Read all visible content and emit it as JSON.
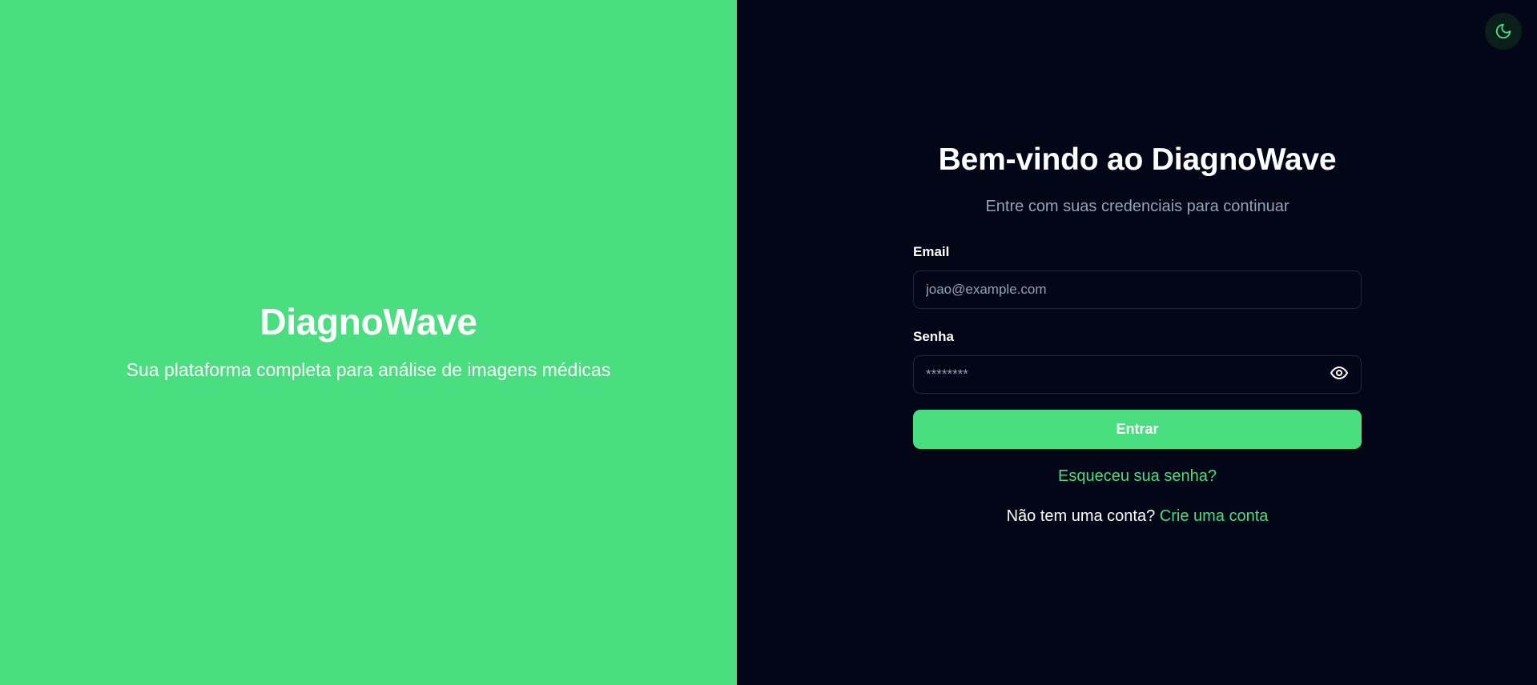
{
  "brand": {
    "title": "DiagnoWave",
    "tagline": "Sua plataforma completa para análise de imagens médicas"
  },
  "theme_toggle": {
    "icon": "moon-icon"
  },
  "login": {
    "title": "Bem-vindo ao DiagnoWave",
    "subtitle": "Entre com suas credenciais para continuar",
    "email_label": "Email",
    "email_placeholder": "joao@example.com",
    "email_value": "",
    "password_label": "Senha",
    "password_placeholder": "********",
    "password_value": "",
    "password_toggle_icon": "eye-icon",
    "submit_label": "Entrar",
    "forgot_link": "Esqueceu sua senha?",
    "signup_prompt": "Não tem uma conta?",
    "signup_link": "Crie uma conta"
  },
  "colors": {
    "accent": "#4ade80",
    "background_dark": "#020617",
    "muted_text": "#94a3b8"
  }
}
